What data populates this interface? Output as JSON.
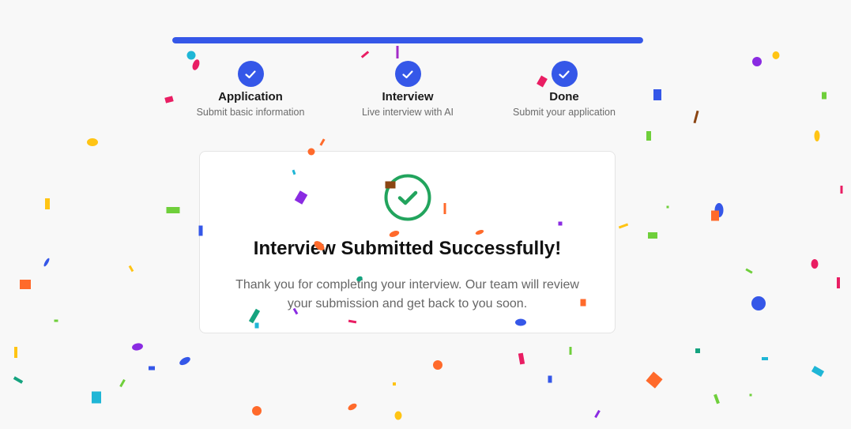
{
  "progress": {
    "completed_fraction": 1.0,
    "color": "#3557e8"
  },
  "steps": [
    {
      "title": "Application",
      "description": "Submit basic information",
      "status": "completed",
      "icon": "check-icon"
    },
    {
      "title": "Interview",
      "description": "Live interview with AI",
      "status": "completed",
      "icon": "check-icon"
    },
    {
      "title": "Done",
      "description": "Submit your application",
      "status": "completed",
      "icon": "check-icon"
    }
  ],
  "success_card": {
    "icon": "check-circle-icon",
    "icon_color": "#22a45d",
    "title": "Interview Submitted Successfully!",
    "message": "Thank you for completing your interview. Our team will review your submission and get back to you soon."
  },
  "confetti_colors": [
    "#1fb6d6",
    "#3557e8",
    "#8a2be2",
    "#ff6a2b",
    "#ffc414",
    "#6fcf3b",
    "#e91e63",
    "#15a37f",
    "#a32bc8",
    "#8b4513"
  ]
}
